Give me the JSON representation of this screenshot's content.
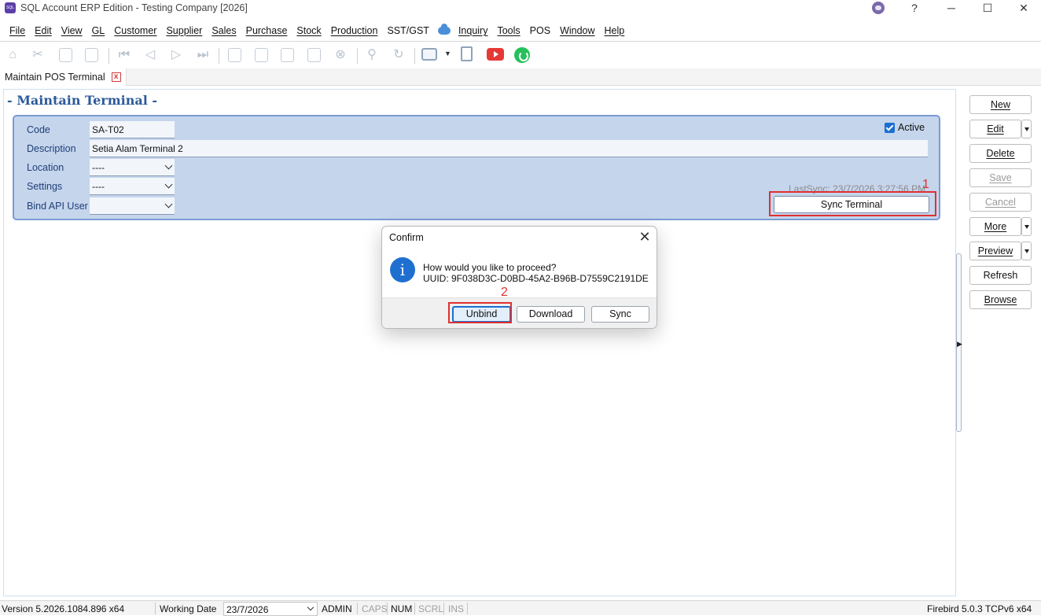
{
  "window": {
    "title": "SQL Account ERP Edition - Testing Company [2026]",
    "help": "?",
    "minimize": "─",
    "maximize": "☐",
    "close": "✕"
  },
  "menu": [
    "File",
    "Edit",
    "View",
    "GL",
    "Customer",
    "Supplier",
    "Sales",
    "Purchase",
    "Stock",
    "Production",
    "SST/GST",
    "Inquiry",
    "Tools",
    "POS",
    "Window",
    "Help"
  ],
  "tab": {
    "label": "Maintain POS Terminal",
    "close": "x"
  },
  "page": {
    "heading": "- Maintain Terminal -"
  },
  "form": {
    "code_label": "Code",
    "code_value": "SA-T02",
    "description_label": "Description",
    "description_value": "Setia Alam Terminal 2",
    "location_label": "Location",
    "location_value": "----",
    "settings_label": "Settings",
    "settings_value": "----",
    "bind_api_user_label": "Bind API User",
    "bind_api_user_value": "",
    "active_label": "Active",
    "active_checked": true,
    "last_sync": "LastSync: 23/7/2026 3:27:56 PM",
    "sync_terminal_label": "Sync Terminal"
  },
  "annotations": {
    "step1": "1",
    "step2": "2",
    "color": "#e03030"
  },
  "side_buttons": {
    "new": "New",
    "edit": "Edit",
    "delete": "Delete",
    "save": "Save",
    "cancel": "Cancel",
    "more": "More",
    "preview": "Preview",
    "refresh": "Refresh",
    "browse": "Browse"
  },
  "dialog": {
    "title": "Confirm",
    "close": "✕",
    "icon": "i",
    "message": "How would you like to proceed?",
    "uuid": "UUID: 9F038D3C-D0BD-45A2-B96B-D7559C2191DE",
    "buttons": {
      "unbind": "Unbind",
      "download": "Download",
      "sync": "Sync"
    }
  },
  "status": {
    "version": "Version 5.2026.1084.896 x64",
    "working_date_label": "Working Date",
    "working_date_value": "23/7/2026",
    "user": "ADMIN",
    "caps": "CAPS",
    "num": "NUM",
    "scrl": "SCRL",
    "ins": "INS",
    "db": "Firebird 5.0.3 TCPv6 x64"
  },
  "colors": {
    "accent": "#1a6fd0",
    "heading": "#2b5a9a",
    "panel": "#c5d5ec"
  },
  "icons": [
    "home-icon",
    "cut-icon",
    "copy-icon",
    "paste-icon",
    "first-icon",
    "prior-icon",
    "next-icon",
    "last-icon",
    "new-doc-icon",
    "edit-doc-icon",
    "delete-doc-icon",
    "save-icon",
    "cancel-icon",
    "search-icon",
    "refresh-icon",
    "print-icon",
    "preview-icon",
    "youtube-icon",
    "whatsapp-icon"
  ]
}
